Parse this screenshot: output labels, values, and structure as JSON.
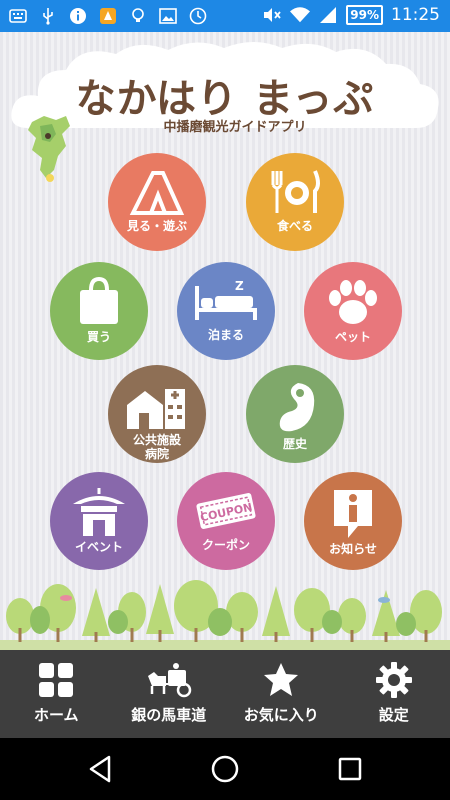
{
  "status_bar": {
    "battery": "99%",
    "time": "11:25"
  },
  "header": {
    "title": "なかはり まっぷ",
    "subtitle": "中播磨観光ガイドアプリ"
  },
  "menu": [
    {
      "label": "見る・遊ぶ",
      "color": "#e87a62",
      "icon": "tent-icon"
    },
    {
      "label": "食べる",
      "color": "#eaa938",
      "icon": "meal-icon"
    },
    {
      "label": "買う",
      "color": "#86b95e",
      "icon": "shopping-bag-icon"
    },
    {
      "label": "泊まる",
      "color": "#6b86c6",
      "icon": "bed-icon"
    },
    {
      "label": "ペット",
      "color": "#e8777c",
      "icon": "paw-icon"
    },
    {
      "label": "公共施設\n病院",
      "color": "#8e6f55",
      "icon": "hospital-icon"
    },
    {
      "label": "歴史",
      "color": "#7fa86a",
      "icon": "magatama-icon"
    },
    {
      "label": "イベント",
      "color": "#8868ab",
      "icon": "shrine-icon"
    },
    {
      "label": "クーポン",
      "color": "#cd6aa0",
      "icon": "coupon-icon"
    },
    {
      "label": "お知らせ",
      "color": "#c8754a",
      "icon": "info-icon"
    }
  ],
  "coupon_text": "COUPON",
  "bottom_nav": [
    {
      "label": "ホーム",
      "icon": "home-grid-icon"
    },
    {
      "label": "銀の馬車道",
      "icon": "horse-carriage-icon"
    },
    {
      "label": "お気に入り",
      "icon": "star-icon"
    },
    {
      "label": "設定",
      "icon": "gear-icon"
    }
  ]
}
